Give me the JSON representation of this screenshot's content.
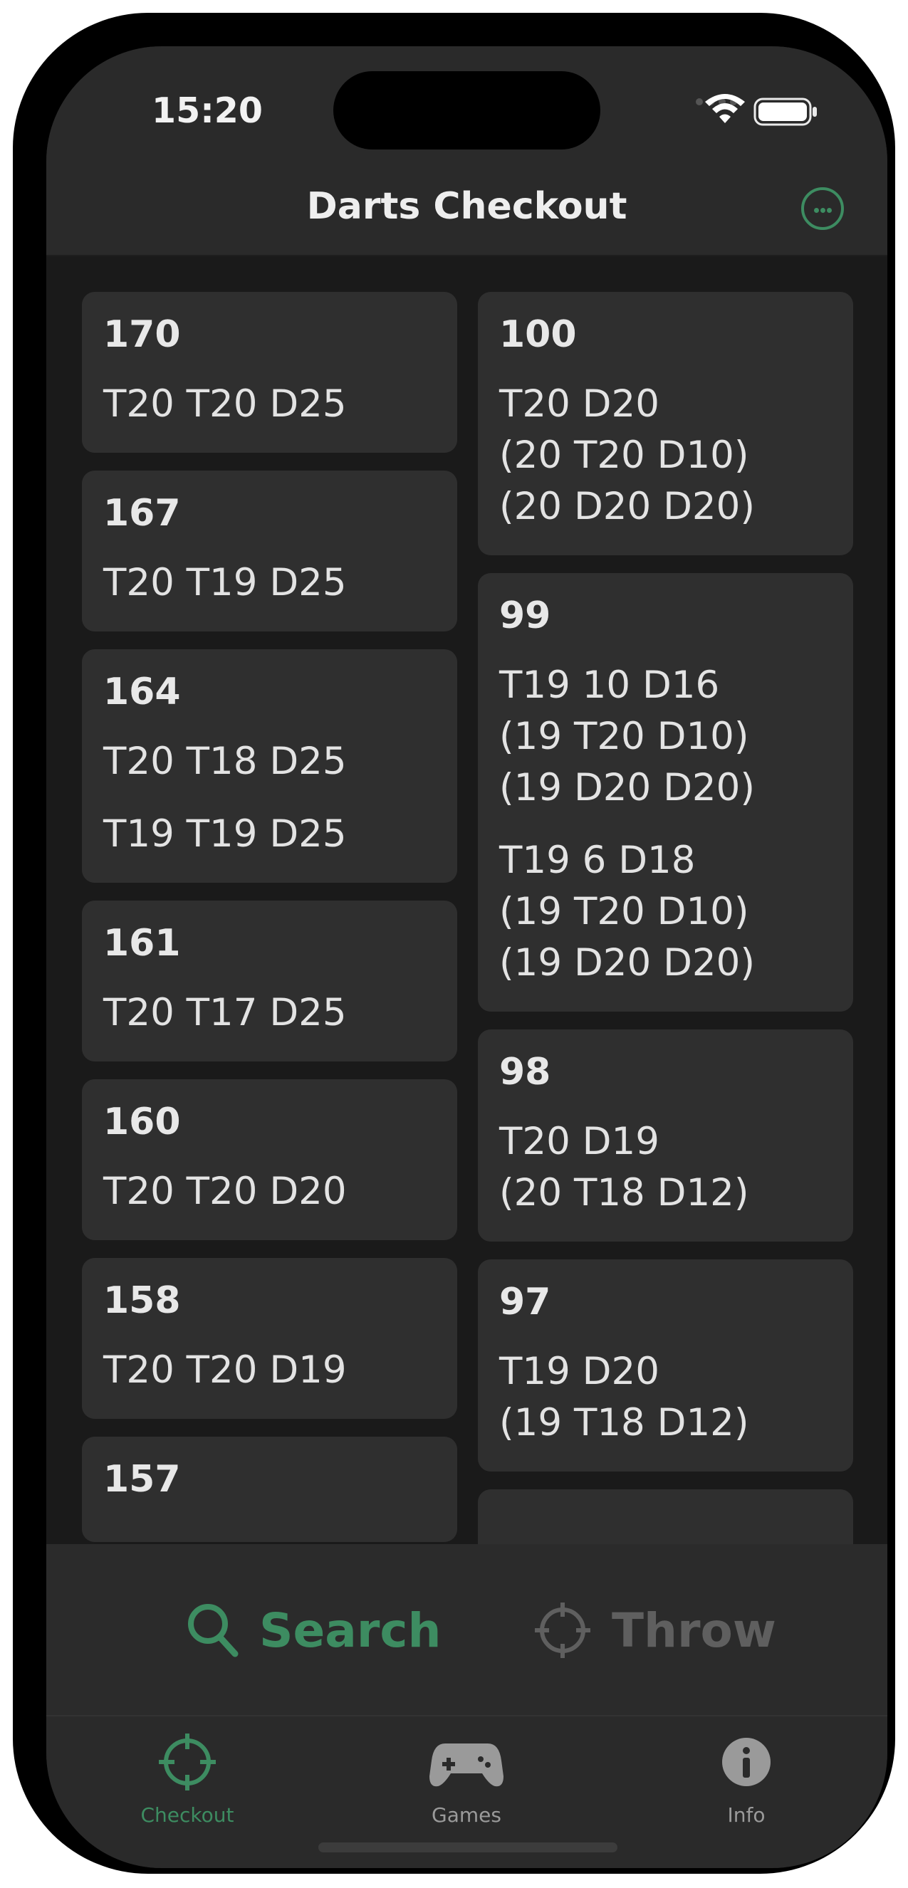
{
  "status_bar": {
    "time": "15:20"
  },
  "header": {
    "title": "Darts Checkout"
  },
  "checkouts_left": [
    {
      "score": "170",
      "routes": [
        "T20 T20 D25"
      ]
    },
    {
      "score": "167",
      "routes": [
        "T20 T19 D25"
      ]
    },
    {
      "score": "164",
      "routes": [
        "T20 T18 D25",
        "T19 T19 D25"
      ]
    },
    {
      "score": "161",
      "routes": [
        "T20 T17 D25"
      ]
    },
    {
      "score": "160",
      "routes": [
        "T20 T20 D20"
      ]
    },
    {
      "score": "158",
      "routes": [
        "T20 T20 D19"
      ]
    },
    {
      "score": "157",
      "routes": [
        ""
      ]
    }
  ],
  "checkouts_right": [
    {
      "score": "100",
      "routes": [
        "T20 D20\n(20 T20 D10)\n(20 D20 D20)"
      ]
    },
    {
      "score": "99",
      "routes": [
        "T19 10 D16\n(19 T20 D10)\n(19 D20 D20)",
        "T19 6 D18\n(19 T20 D10)\n(19 D20 D20)"
      ]
    },
    {
      "score": "98",
      "routes": [
        "T20 D19\n(20 T18 D12)"
      ]
    },
    {
      "score": "97",
      "routes": [
        "T19 D20\n(19 T18 D12)"
      ]
    },
    {
      "score": "",
      "routes": [
        ""
      ]
    }
  ],
  "mode_bar": {
    "search_label": "Search",
    "throw_label": "Throw"
  },
  "tabs": [
    {
      "label": "Checkout",
      "icon": "crosshair-icon",
      "selected": true
    },
    {
      "label": "Games",
      "icon": "gamecontroller-icon",
      "selected": false
    },
    {
      "label": "Info",
      "icon": "info-icon",
      "selected": false
    }
  ],
  "colors": {
    "accent": "#3d8c61",
    "background": "#1a1a1a",
    "card": "#2f2f2f",
    "inactive": "#5f5f5f"
  }
}
